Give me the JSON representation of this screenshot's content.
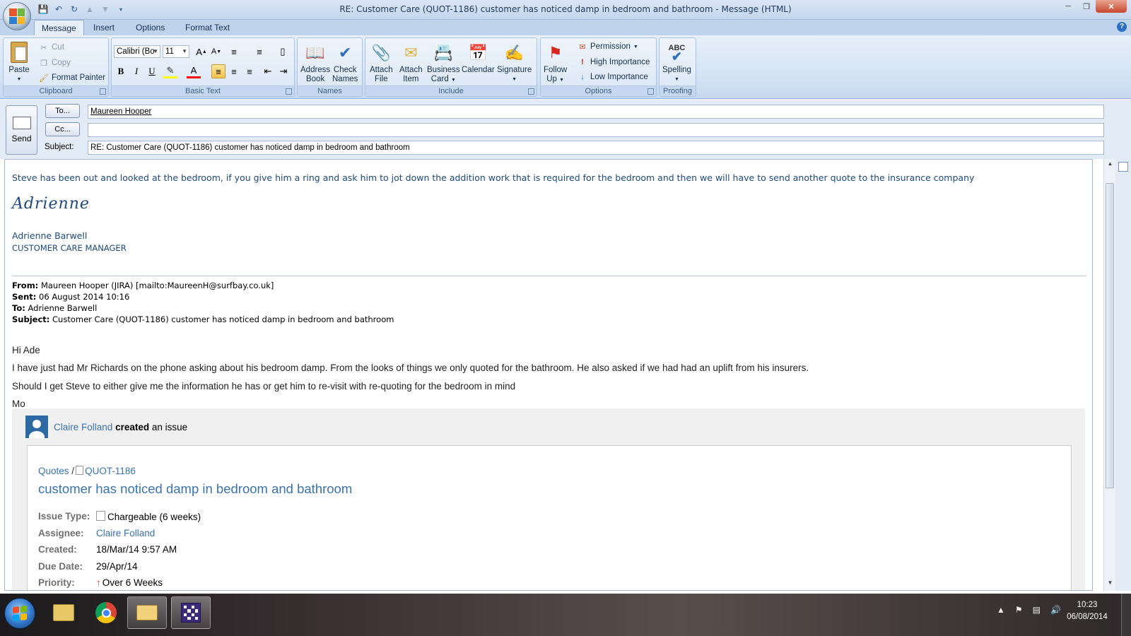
{
  "window": {
    "title": "RE: Customer Care (QUOT-1186) customer has noticed damp in bedroom and bathroom - Message (HTML)"
  },
  "tabs": [
    "Message",
    "Insert",
    "Options",
    "Format Text"
  ],
  "ribbon": {
    "clipboard": {
      "label": "Clipboard",
      "paste": "Paste",
      "cut": "Cut",
      "copy": "Copy",
      "format_painter": "Format Painter"
    },
    "basic_text": {
      "label": "Basic Text",
      "font": "Calibri (Bo",
      "size": "11"
    },
    "names": {
      "label": "Names",
      "address_book": [
        "Address",
        "Book"
      ],
      "check_names": [
        "Check",
        "Names"
      ]
    },
    "include": {
      "label": "Include",
      "attach_file": [
        "Attach",
        "File"
      ],
      "attach_item": [
        "Attach",
        "Item"
      ],
      "business_card": [
        "Business",
        "Card"
      ],
      "calendar": "Calendar",
      "signature": "Signature"
    },
    "options": {
      "label": "Options",
      "follow_up": [
        "Follow",
        "Up"
      ],
      "permission": "Permission",
      "high_importance": "High Importance",
      "low_importance": "Low Importance"
    },
    "proofing": {
      "label": "Proofing",
      "spelling": "Spelling",
      "abc": "ABC"
    }
  },
  "header": {
    "send": "Send",
    "to_button": "To...",
    "cc_button": "Cc...",
    "subject_label": "Subject:",
    "to_value": "Maureen Hooper",
    "cc_value": "",
    "subject_value": "RE: Customer Care (QUOT-1186) customer has noticed damp in bedroom and bathroom"
  },
  "body": {
    "intro": "Steve has been out and looked at the bedroom, if you give him a ring and ask him to jot down the addition work that is required for the bedroom and then we will have to send another quote to the insurance company",
    "signature_script": "Adrienne",
    "signature_name": "Adrienne Barwell",
    "signature_title": "CUSTOMER CARE MANAGER",
    "quoted": {
      "from_label": "From:",
      "from": "Maureen Hooper (JIRA) [mailto:MaureenH@surfbay.co.uk]",
      "sent_label": "Sent:",
      "sent": "06 August 2014 10:16",
      "to_label": "To:",
      "to": "Adrienne Barwell",
      "subject_label": "Subject:",
      "subject": "Customer Care (QUOT-1186) customer has noticed damp in bedroom and bathroom"
    },
    "greeting": "Hi Ade",
    "para1": "I have just had Mr Richards on the phone asking about his bedroom damp. From the looks of things we only quoted for the bathroom. He also asked if we had had an uplift from his insurers.",
    "para2": "Should I get Steve to either give me the information he has or get him to re-visit with re-quoting for the bedroom in mind",
    "signoff": "Mo"
  },
  "jira": {
    "actor": "Claire Folland",
    "action_bold": "created",
    "action_rest": "an issue",
    "breadcrumb_project": "Quotes",
    "breadcrumb_sep": "/",
    "issue_key": "QUOT-1186",
    "issue_title": "customer has noticed damp in bedroom and bathroom",
    "fields": [
      {
        "label": "Issue Type:",
        "value": "Chargeable (6 weeks)"
      },
      {
        "label": "Assignee:",
        "value": "Claire Folland"
      },
      {
        "label": "Created:",
        "value": "18/Mar/14 9:57 AM"
      },
      {
        "label": "Due Date:",
        "value": "29/Apr/14"
      },
      {
        "label": "Priority:",
        "value": "Over 6 Weeks"
      }
    ]
  },
  "taskbar": {
    "time": "10:23",
    "date": "06/08/2014"
  },
  "colors": {
    "link": "#3b73af",
    "signature_blue": "#1f497d",
    "ribbon_bg": "#dbe7f6"
  }
}
